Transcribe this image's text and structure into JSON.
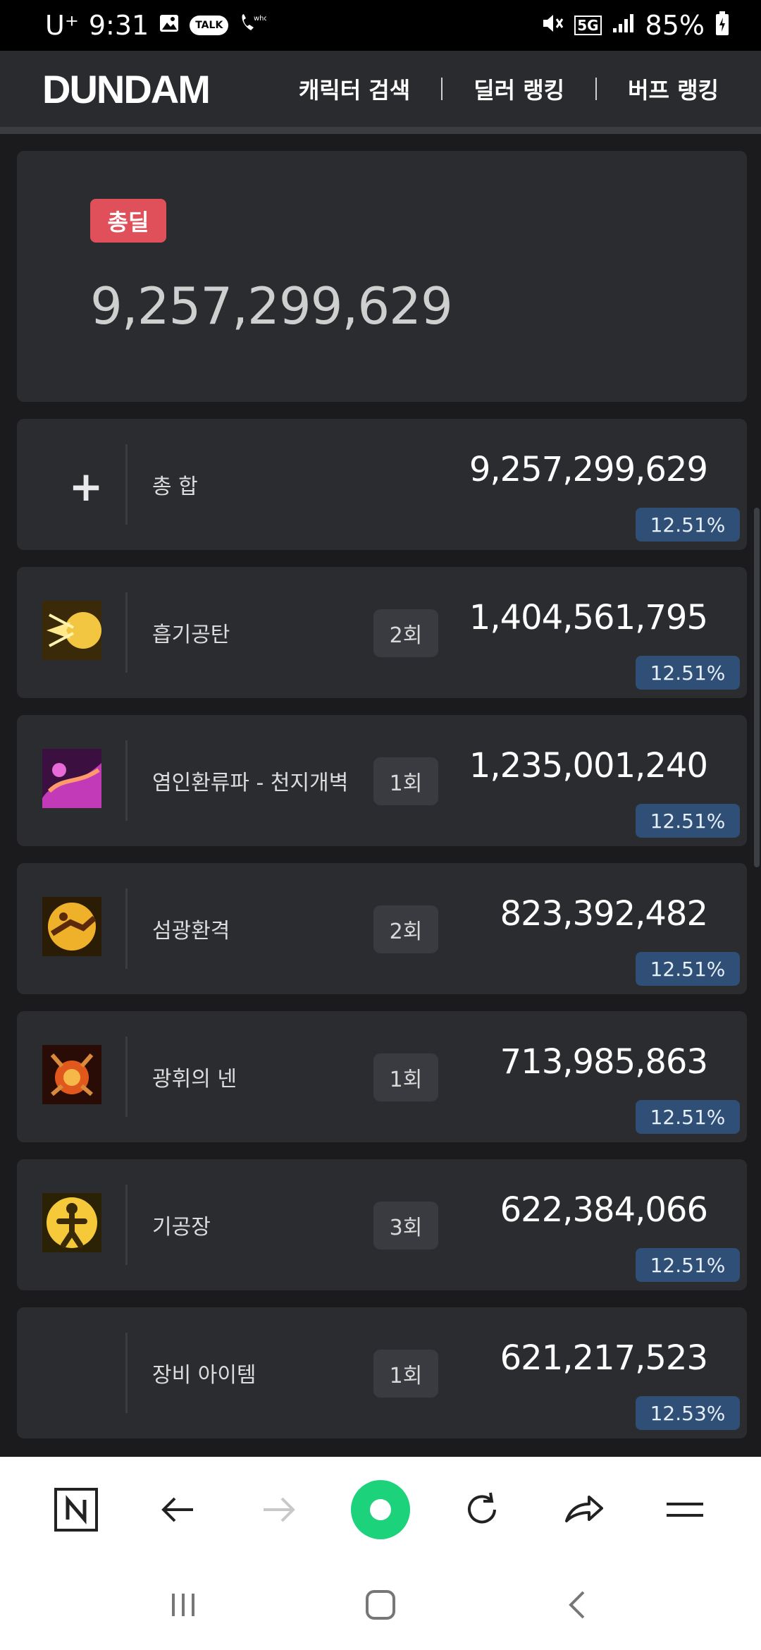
{
  "status_bar": {
    "carrier": "U⁺",
    "time": "9:31",
    "network": "5G",
    "battery": "85%"
  },
  "header": {
    "logo": "DUNDAM",
    "nav": [
      "캐릭터 검색",
      "딜러 랭킹",
      "버프 랭킹"
    ]
  },
  "total": {
    "badge": "총딜",
    "value": "9,257,299,629"
  },
  "rows": [
    {
      "name": "총 합",
      "count": "",
      "damage": "9,257,299,629",
      "pct": "12.51%"
    },
    {
      "name": "흡기공탄",
      "count": "2회",
      "damage": "1,404,561,795",
      "pct": "12.51%"
    },
    {
      "name": "염인환류파 - 천지개벽",
      "count": "1회",
      "damage": "1,235,001,240",
      "pct": "12.51%"
    },
    {
      "name": "섬광환격",
      "count": "2회",
      "damage": "823,392,482",
      "pct": "12.51%"
    },
    {
      "name": "광휘의 넨",
      "count": "1회",
      "damage": "713,985,863",
      "pct": "12.51%"
    },
    {
      "name": "기공장",
      "count": "3회",
      "damage": "622,384,066",
      "pct": "12.51%"
    },
    {
      "name": "장비 아이템",
      "count": "1회",
      "damage": "621,217,523",
      "pct": "12.53%"
    }
  ],
  "icons": {
    "accent_badge": "#e0505a",
    "pct_badge": "#2f4f77",
    "browser_home": "#1cd27a"
  }
}
